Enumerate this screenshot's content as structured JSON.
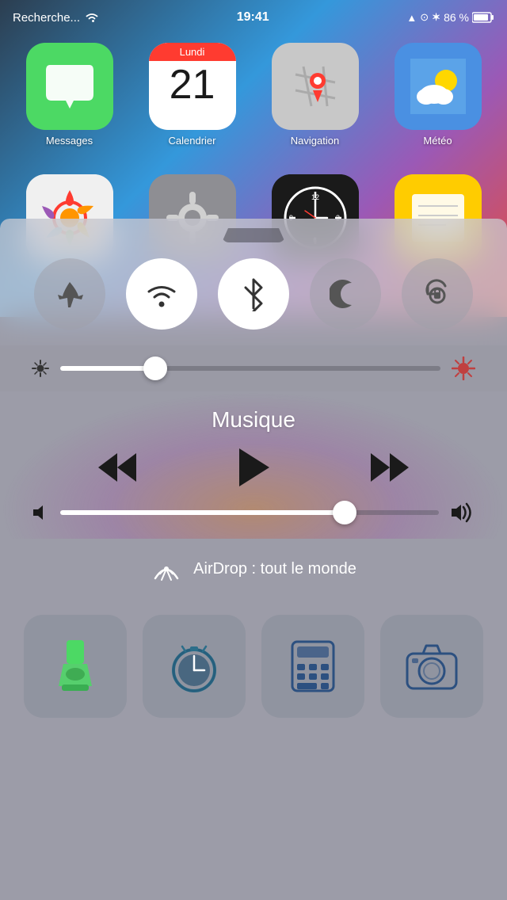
{
  "status_bar": {
    "carrier": "Recherche...",
    "wifi_signal": "wifi",
    "time": "19:41",
    "gps": "▲",
    "alarm": "⏰",
    "bluetooth": "✳",
    "battery_pct": "86 %",
    "battery": "🔋"
  },
  "apps": {
    "row1": [
      {
        "name": "Messages",
        "label": "Messages"
      },
      {
        "name": "Calendrier",
        "label": "Calendrier",
        "day_name": "Lundi",
        "day_num": "21"
      },
      {
        "name": "Navigation",
        "label": "Navigation"
      },
      {
        "name": "Météo",
        "label": "Météo"
      }
    ]
  },
  "control_center": {
    "toggles": [
      {
        "id": "airplane",
        "label": "Airplane Mode",
        "active": false
      },
      {
        "id": "wifi",
        "label": "Wi-Fi",
        "active": true
      },
      {
        "id": "bluetooth",
        "label": "Bluetooth",
        "active": true
      },
      {
        "id": "donotdisturb",
        "label": "Do Not Disturb",
        "active": false
      },
      {
        "id": "rotation",
        "label": "Rotation Lock",
        "active": false
      }
    ],
    "brightness_pct": 25,
    "music": {
      "title": "Musique"
    },
    "volume_pct": 75,
    "airdrop": {
      "label": "AirDrop : tout le monde"
    },
    "quick_actions": [
      {
        "id": "flashlight",
        "label": "Flashlight"
      },
      {
        "id": "timer",
        "label": "Timer"
      },
      {
        "id": "calculator",
        "label": "Calculator"
      },
      {
        "id": "camera",
        "label": "Camera"
      }
    ]
  }
}
